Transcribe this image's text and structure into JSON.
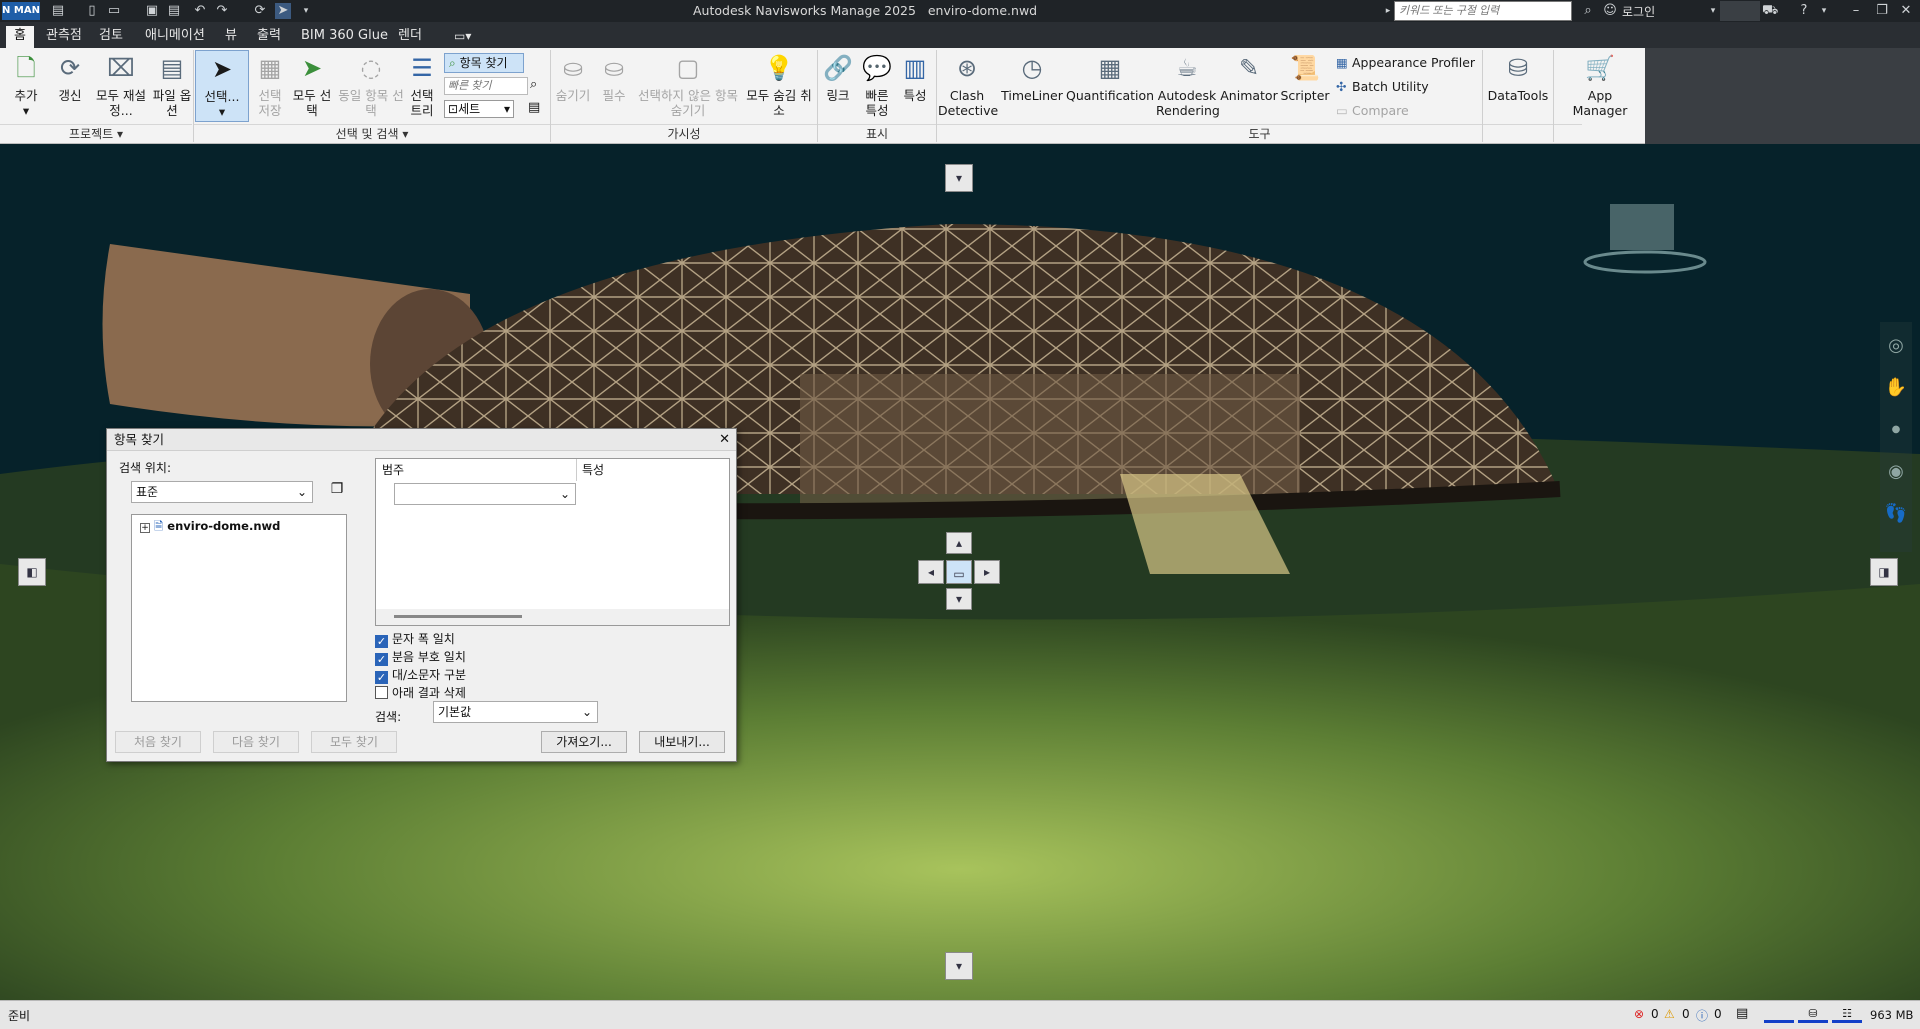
{
  "app": {
    "title": "Autodesk Navisworks Manage 2025",
    "file": "enviro-dome.nwd",
    "badge": "N MAN",
    "search_placeholder": "키워드 또는 구절 입력",
    "login": "로그인"
  },
  "menu_tabs": [
    "홈",
    "관측점",
    "검토",
    "애니메이션",
    "뷰",
    "출력",
    "BIM 360 Glue",
    "렌더"
  ],
  "ribbon": {
    "project": {
      "label": "프로젝트",
      "buttons": [
        "추가",
        "갱신",
        "모두 재설정...",
        "파일 옵션"
      ]
    },
    "select": {
      "label": "선택 및 검색",
      "buttons": [
        "선택...",
        "선택 저장",
        "모두 선택",
        "동일 항목 선택",
        "선택 트리"
      ],
      "find_items": "항목 찾기",
      "quick_find_placeholder": "빠른 찾기",
      "sets": "세트"
    },
    "visibility": {
      "label": "가시성",
      "buttons": [
        "숨기기",
        "필수",
        "선택하지 않은 항목 숨기기",
        "모두 숨김 취소"
      ]
    },
    "display": {
      "label": "표시",
      "buttons": [
        "링크",
        "빠른 특성",
        "특성"
      ]
    },
    "tools": {
      "label": "도구",
      "buttons": [
        "Clash Detective",
        "TimeLiner",
        "Quantification",
        "Autodesk Rendering",
        "Animator",
        "Scripter"
      ],
      "small": [
        "Appearance Profiler",
        "Batch Utility",
        "Compare"
      ]
    },
    "extra": [
      "DataTools",
      "App Manager"
    ]
  },
  "dialog": {
    "title": "항목 찾기",
    "search_location_label": "검색 위치:",
    "location_value": "표준",
    "tree_item": "enviro-dome.nwd",
    "col_category": "범주",
    "col_property": "특성",
    "checkboxes": [
      {
        "label": "문자 폭 일치",
        "checked": true
      },
      {
        "label": "분음 부호 일치",
        "checked": true
      },
      {
        "label": "대/소문자 구분",
        "checked": true
      },
      {
        "label": "아래 결과 삭제",
        "checked": false
      }
    ],
    "search_label": "검색:",
    "search_value": "기본값",
    "buttons": {
      "find_first": "처음 찾기",
      "find_next": "다음 찾기",
      "find_all": "모두 찾기",
      "import": "가져오기...",
      "export": "내보내기..."
    }
  },
  "status": {
    "ready": "준비",
    "errors": "0",
    "warnings": "0",
    "info": "0",
    "memory": "963 MB"
  }
}
